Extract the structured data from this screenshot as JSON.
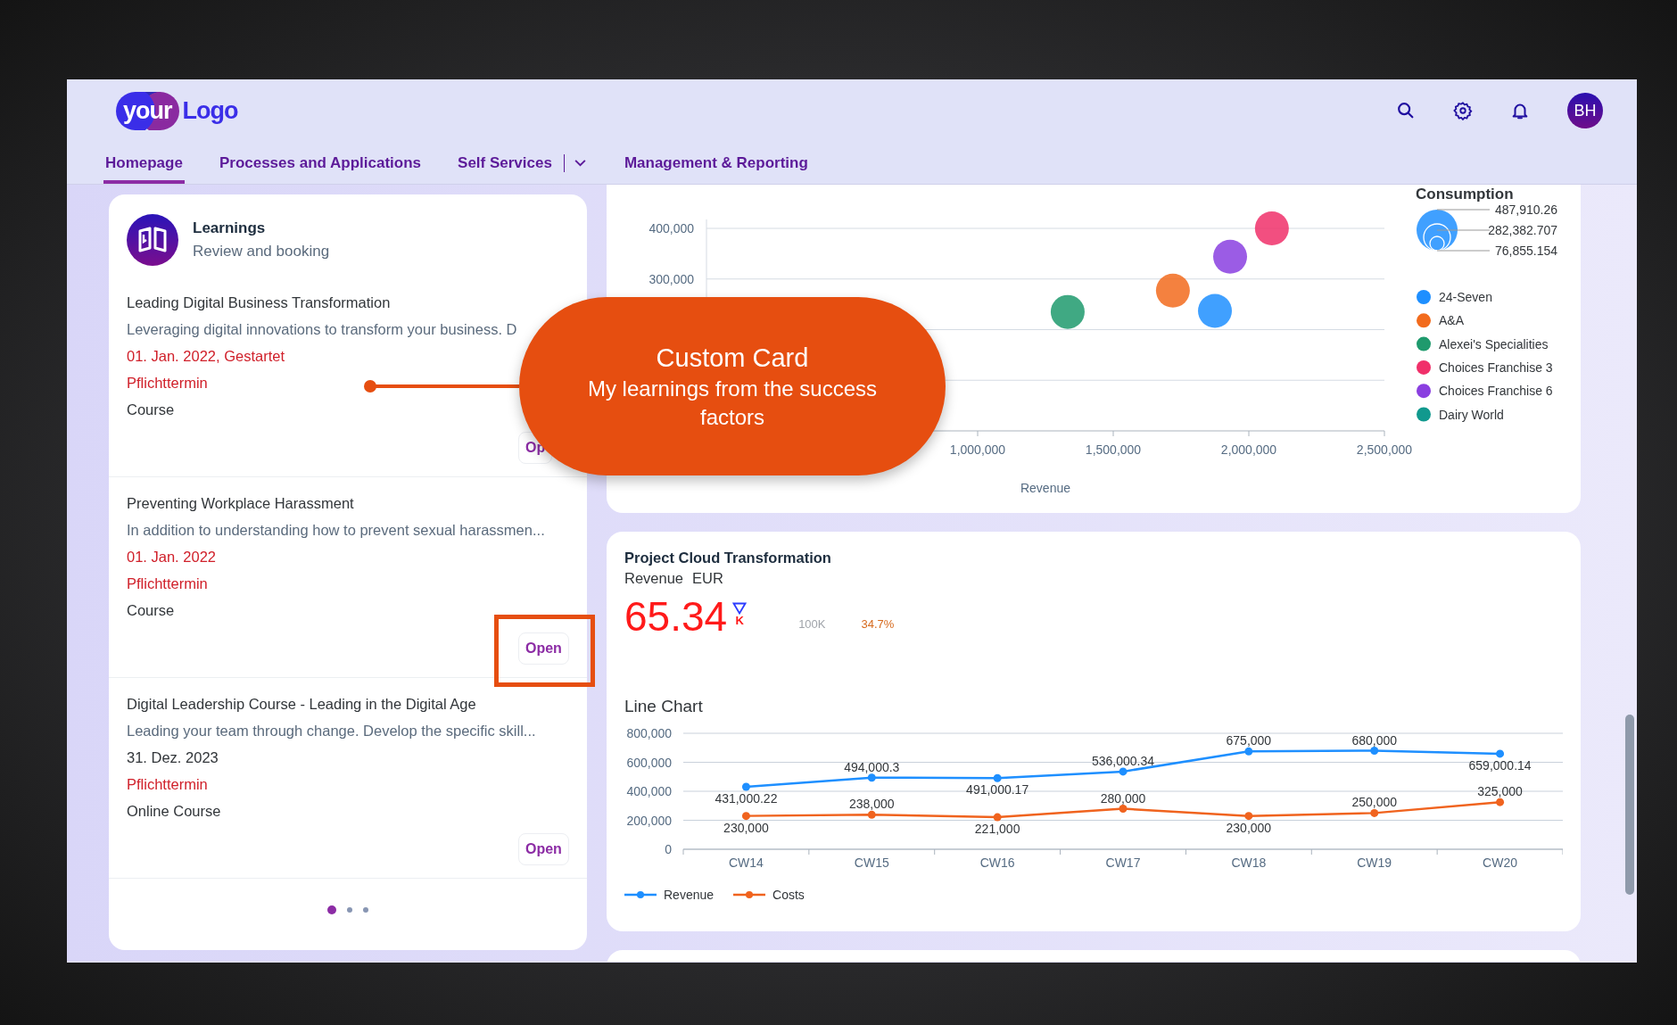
{
  "header": {
    "logo": {
      "mark": "your",
      "text": "Logo"
    },
    "avatar": "BH"
  },
  "tabs": [
    {
      "label": "Homepage",
      "selected": true,
      "has_menu": false
    },
    {
      "label": "Processes and Applications",
      "selected": false,
      "has_menu": false
    },
    {
      "label": "Self Services",
      "selected": false,
      "has_menu": true
    },
    {
      "label": "Management & Reporting",
      "selected": false,
      "has_menu": false
    }
  ],
  "learnings_card": {
    "title": "Learnings",
    "subtitle": "Review and booking",
    "items": [
      {
        "title": "Leading Digital Business Transformation",
        "description": "Leveraging digital innovations to transform your business. D",
        "date": "01. Jan. 2022, Gestartet",
        "date_highlighted": true,
        "requirement": "Pflichttermin",
        "type": "Course",
        "action": "Op",
        "highlighted": false
      },
      {
        "title": "Preventing Workplace Harassment",
        "description": "In addition to understanding how to prevent sexual harassmen...",
        "date": "01. Jan. 2022",
        "date_highlighted": true,
        "requirement": "Pflichttermin",
        "type": "Course",
        "action": "Open",
        "highlighted": true
      },
      {
        "title": "Digital Leadership Course - Leading in the Digital Age",
        "description": "Leading your team through change. Develop the specific skill...",
        "date": "31. Dez. 2023",
        "date_highlighted": false,
        "requirement": "Pflichttermin",
        "type": "Online Course",
        "action": "Open",
        "highlighted": false
      }
    ],
    "pages": [
      {
        "selected": true
      },
      {
        "selected": false
      },
      {
        "selected": false
      }
    ]
  },
  "bubble_card": {
    "chart_data": {
      "type": "scatter",
      "xlabel": "Revenue",
      "xlim": [
        0,
        2500000
      ],
      "ylim": [
        0,
        400000
      ],
      "legend": "right",
      "xticks": [
        {
          "value": 1000000,
          "label": "1,000,000"
        },
        {
          "value": 1500000,
          "label": "1,500,000"
        },
        {
          "value": 2000000,
          "label": "2,000,000"
        },
        {
          "value": 2500000,
          "label": "2,500,000"
        }
      ],
      "yticks": [
        {
          "value": 300000,
          "label": "300,000"
        },
        {
          "value": 400000,
          "label": "400,000"
        }
      ],
      "series": [
        {
          "name": "24-Seven",
          "color": "#1e8fff",
          "x": [
            1875000
          ],
          "values": [
            237000
          ]
        },
        {
          "name": "A&A",
          "color": "#f26b1d",
          "x": [
            1720000
          ],
          "values": [
            277000
          ]
        },
        {
          "name": "Alexei's Specialities",
          "color": "#1f9a6d",
          "x": [
            1332000
          ],
          "values": [
            235000
          ]
        },
        {
          "name": "Choices Franchise 3",
          "color": "#f0306a",
          "x": [
            2085000
          ],
          "values": [
            400000
          ]
        },
        {
          "name": "Choices Franchise 6",
          "color": "#8a3fe0",
          "x": [
            1931000
          ],
          "values": [
            344000
          ]
        },
        {
          "name": "Dairy World",
          "color": "#11998e",
          "x": [
            null
          ],
          "values": [
            null
          ]
        }
      ]
    },
    "size_legend": {
      "title": "Consumption",
      "values": [
        "487,910.26",
        "282,382.707",
        "76,855.154"
      ]
    }
  },
  "kpi_card": {
    "title": "Project Cloud Transformation",
    "measure": "Revenue",
    "unit": "EUR",
    "value": "65.34",
    "scale": "K",
    "trend_down": true,
    "target": "100K",
    "deviation": "34.7%",
    "chart_data": {
      "type": "line",
      "title": "Line Chart",
      "categories": [
        "CW14",
        "CW15",
        "CW16",
        "CW17",
        "CW18",
        "CW19",
        "CW20"
      ],
      "ylim": [
        0,
        800000
      ],
      "grid": true,
      "data_labels": true,
      "yticks": [
        0,
        {
          "value": 200000,
          "label": "200,000"
        },
        {
          "value": 400000,
          "label": "400,000"
        },
        {
          "value": 600000,
          "label": "600,000"
        },
        {
          "value": 800000,
          "label": "800,000"
        }
      ],
      "series": [
        {
          "name": "Revenue",
          "color": "#1e8fff",
          "marker": true,
          "values": [
            431000.22,
            494000.3,
            491000.17,
            536000.34,
            675000,
            680000,
            659000.14
          ],
          "value_labels": [
            "431,000.22",
            "494,000.3",
            "491,000.17",
            "536,000.34",
            "675,000",
            "680,000",
            "659,000.14"
          ]
        },
        {
          "name": "Costs",
          "color": "#f0631e",
          "marker": true,
          "values": [
            230000,
            238000,
            221000,
            280000,
            230000,
            250000,
            325000
          ],
          "value_labels": [
            "230,000",
            "238,000",
            "221,000",
            "280,000",
            "230,000",
            "250,000",
            "325,000"
          ]
        }
      ]
    }
  },
  "callout": {
    "title": "Custom Card",
    "text": "My learnings from the success factors"
  }
}
